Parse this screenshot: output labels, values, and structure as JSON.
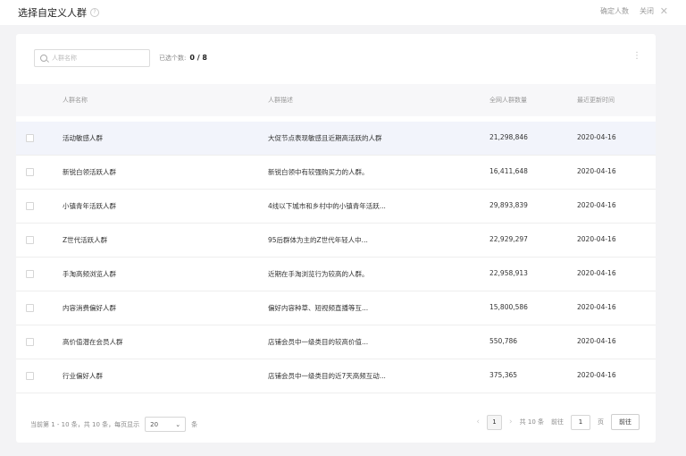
{
  "header": {
    "title": "选择自定义人群",
    "help_icon": "?",
    "action_confirm": "确定人数",
    "action_close": "关闭",
    "close_icon": "✕"
  },
  "toolbar": {
    "search_placeholder": "人群名称",
    "selected_label": "已选个数:",
    "selected_value": "0 / 8",
    "more_icon": "⋮"
  },
  "table": {
    "columns": [
      "人群名称",
      "人群描述",
      "全网人群数量",
      "最近更新时间"
    ],
    "rows": [
      {
        "name": "活动敏感人群",
        "desc": "大促节点表现敏感且近期高活跃的人群",
        "count": "21,298,846",
        "date": "2020-04-16"
      },
      {
        "name": "新锐白领活跃人群",
        "desc": "新锐白领中有较强购买力的人群。",
        "count": "16,411,648",
        "date": "2020-04-16"
      },
      {
        "name": "小镇青年活跃人群",
        "desc": "4线以下城市和乡村中的小镇青年活跃...",
        "count": "29,893,839",
        "date": "2020-04-16"
      },
      {
        "name": "Z世代活跃人群",
        "desc": "95后群体为主的Z世代年轻人中...",
        "count": "22,929,297",
        "date": "2020-04-16"
      },
      {
        "name": "手淘高频浏览人群",
        "desc": "近期在手淘浏览行为较高的人群。",
        "count": "22,958,913",
        "date": "2020-04-16"
      },
      {
        "name": "内容消费偏好人群",
        "desc": "偏好内容种草、短视频直播等互...",
        "count": "15,800,586",
        "date": "2020-04-16"
      },
      {
        "name": "高价值潜在会员人群",
        "desc": "店铺会员中一级类目的较高价值...",
        "count": "550,786",
        "date": "2020-04-16"
      },
      {
        "name": "行业偏好人群",
        "desc": "店铺会员中一级类目的近7天高频互动...",
        "count": "375,365",
        "date": "2020-04-16"
      }
    ]
  },
  "footer": {
    "summary": "当前第 1 - 10 条，共 10 条，每页显示",
    "page_size": "20",
    "page_size_unit": "条",
    "prev_icon": "‹",
    "current_page": "1",
    "next_icon": "›",
    "total_pages": "共 10 条",
    "goto_label": "前往",
    "goto_value": "1",
    "goto_unit": "页",
    "go_button": "前往"
  }
}
